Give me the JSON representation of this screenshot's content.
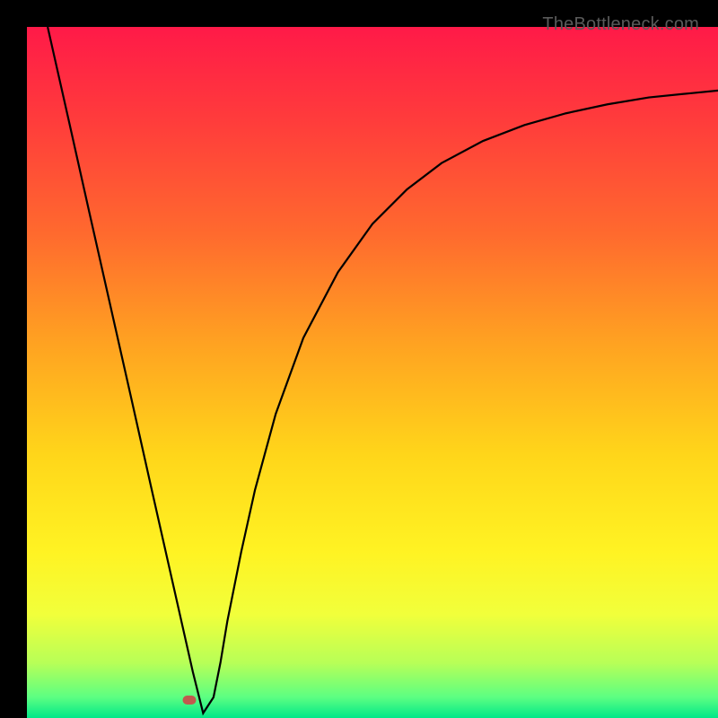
{
  "watermark": "TheBottleneck.com",
  "chart_data": {
    "type": "line",
    "title": "",
    "xlabel": "",
    "ylabel": "",
    "xlim": [
      0,
      100
    ],
    "ylim": [
      0,
      100
    ],
    "grid": false,
    "background_gradient": {
      "stops": [
        {
          "offset": 0.0,
          "color": "#ff1a48"
        },
        {
          "offset": 0.14,
          "color": "#ff3d3b"
        },
        {
          "offset": 0.3,
          "color": "#ff6a2e"
        },
        {
          "offset": 0.46,
          "color": "#ffa321"
        },
        {
          "offset": 0.62,
          "color": "#ffd61a"
        },
        {
          "offset": 0.76,
          "color": "#fff323"
        },
        {
          "offset": 0.85,
          "color": "#f1ff3b"
        },
        {
          "offset": 0.92,
          "color": "#b8ff57"
        },
        {
          "offset": 0.97,
          "color": "#5cff82"
        },
        {
          "offset": 1.0,
          "color": "#00e888"
        }
      ]
    },
    "series": [
      {
        "name": "bottleneck-curve",
        "color": "#000000",
        "x": [
          3,
          6,
          9,
          12,
          15,
          18,
          21,
          24,
          25.5,
          27,
          28,
          29,
          31,
          33,
          36,
          40,
          45,
          50,
          55,
          60,
          66,
          72,
          78,
          84,
          90,
          96,
          100
        ],
        "y": [
          100,
          86.7,
          73.3,
          60.0,
          46.7,
          33.3,
          20.0,
          6.7,
          0.7,
          3.0,
          8.0,
          14.0,
          24.0,
          33.0,
          44.0,
          55.0,
          64.5,
          71.5,
          76.5,
          80.3,
          83.5,
          85.8,
          87.5,
          88.8,
          89.8,
          90.4,
          90.8
        ]
      }
    ],
    "marker": {
      "x": 25.5,
      "y": 0.7,
      "name": "optimum-point",
      "color": "#c15a4e"
    }
  }
}
